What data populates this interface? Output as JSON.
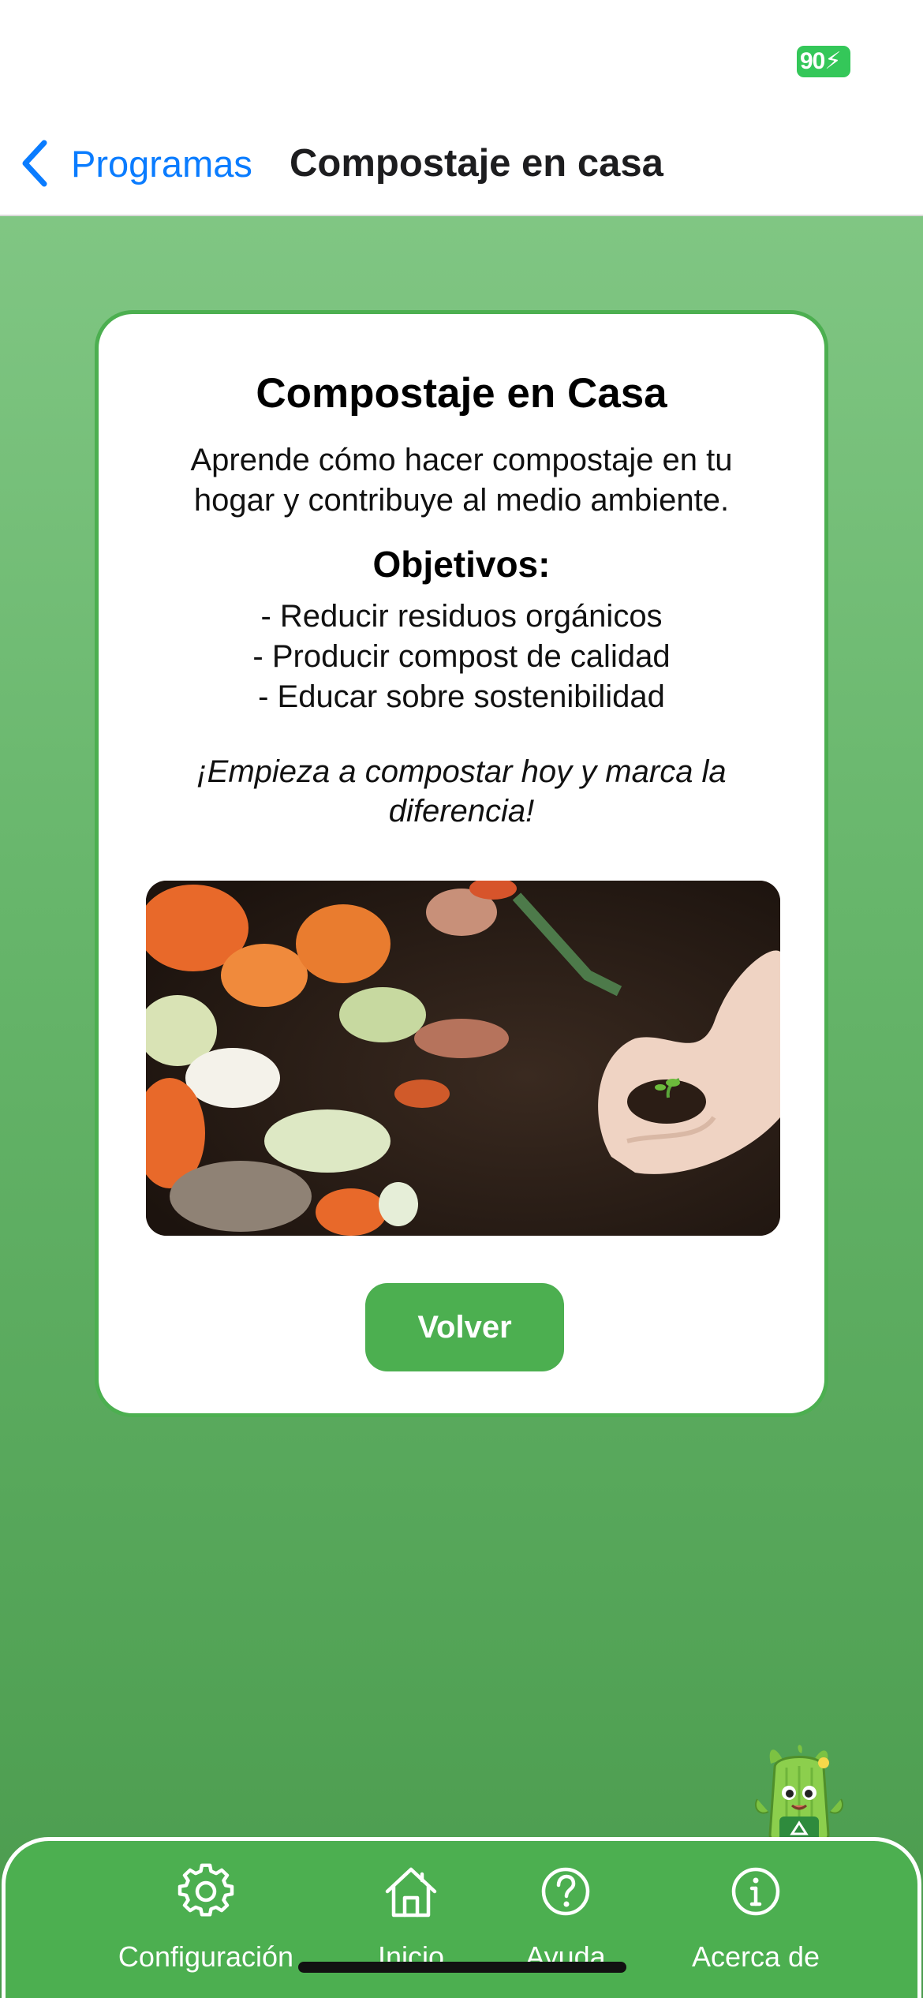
{
  "status_bar": {
    "battery_level": "90"
  },
  "nav": {
    "back_label": "Programas",
    "title": "Compostaje en casa"
  },
  "card": {
    "title": "Compostaje en Casa",
    "description": "Aprende cómo hacer compostaje en tu hogar y contribuye al medio ambiente.",
    "objectives_title": "Objetivos:",
    "objectives": [
      "- Reducir residuos orgánicos",
      "- Producir compost de calidad",
      "- Educar sobre sostenibilidad"
    ],
    "cta": "¡Empieza a compostar hoy y marca la diferencia!",
    "button_label": "Volver"
  },
  "tabs": [
    {
      "label": "Configuración",
      "icon": "gear-icon"
    },
    {
      "label": "Inicio",
      "icon": "home-icon"
    },
    {
      "label": "Ayuda",
      "icon": "question-icon"
    },
    {
      "label": "Acerca de",
      "icon": "info-icon"
    }
  ],
  "colors": {
    "accent_green": "#4caf50",
    "link_blue": "#0a7cff",
    "battery_green": "#34c759"
  }
}
